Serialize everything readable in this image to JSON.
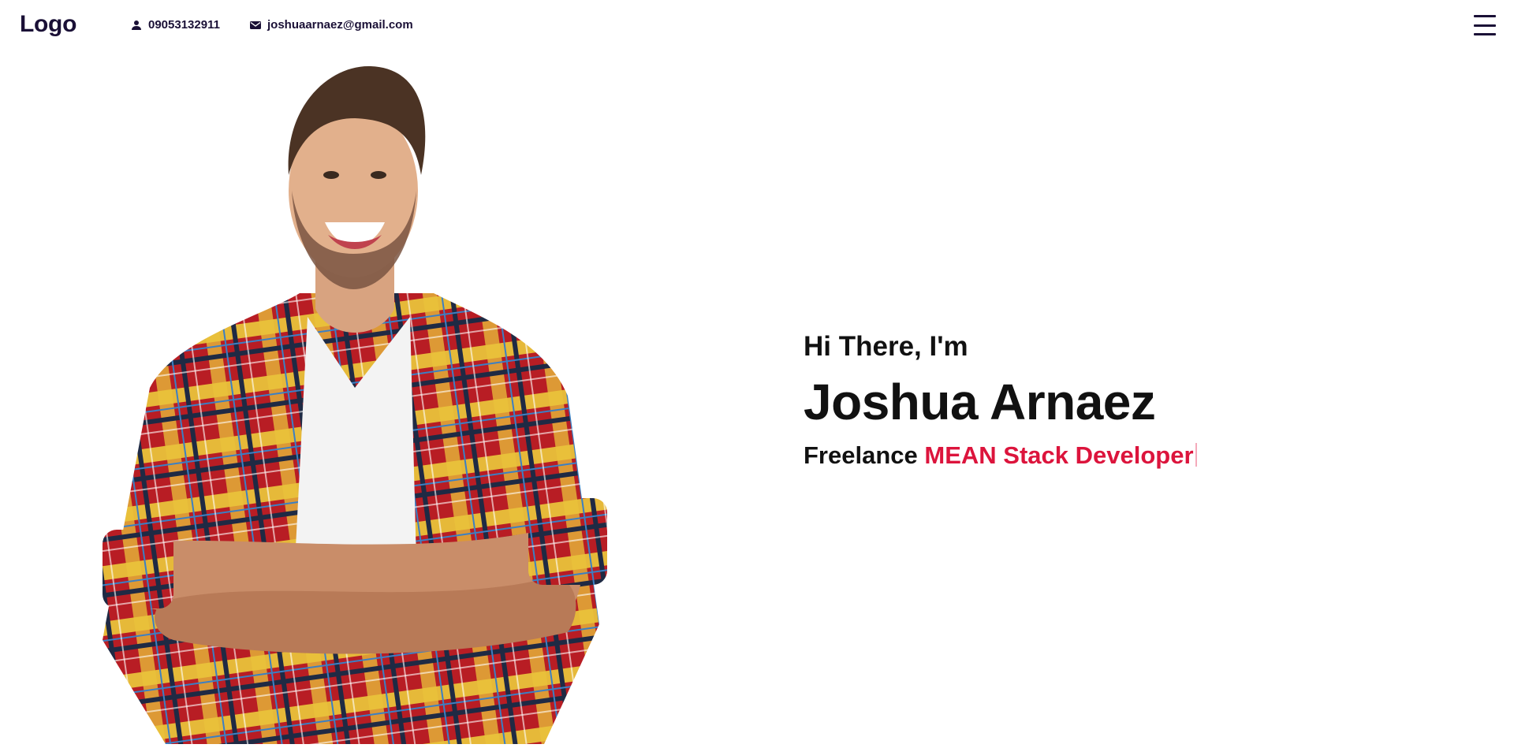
{
  "header": {
    "logo": "Logo",
    "phone": "09053132911",
    "email": "joshuaarnaez@gmail.com",
    "phone_icon": "person-icon",
    "email_icon": "mail-icon",
    "menu_icon": "hamburger-menu-icon"
  },
  "hero": {
    "photo": "smiling man in plaid shirt with crossed arms",
    "greeting": "Hi There, I'm",
    "name": "Joshua Arnaez",
    "role_prefix": "Freelance",
    "role_typed": "MEAN Stack Developer"
  },
  "colors": {
    "accent": "#dc143c",
    "nav_text": "#1a1036",
    "text": "#111111",
    "background": "#ffffff"
  }
}
